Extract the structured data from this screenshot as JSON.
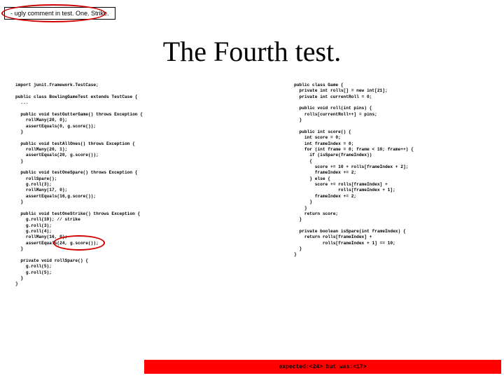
{
  "annotation": "- ugly comment in test. One. Strike.",
  "title": "The Fourth test.",
  "code_left": "import junit.framework.TestCase;\n\npublic class BowlingGameTest extends TestCase {\n  ...\n\n  public void testGutterGame() throws Exception {\n    rollMany(20, 0);\n    assertEquals(0, g.score());\n  }\n\n  public void testAllOnes() throws Exception {\n    rollMany(20, 1);\n    assertEquals(20, g.score());\n  }\n\n  public void testOneSpare() throws Exception {\n    rollSpare();\n    g.roll(3);\n    rollMany(17, 0);\n    assertEquals(16,g.score());\n  }\n\n  public void testOneStrike() throws Exception {\n    g.roll(10); // strike\n    g.roll(3);\n    g.roll(4);\n    rollMany(16, 0);\n    assertEquals(24, g.score());\n  }\n\n  private void rollSpare() {\n    g.roll(5);\n    g.roll(5);\n  }\n}",
  "code_right": "public class Game {\n  private int rolls[] = new int[21];\n  private int currentRoll = 0;\n\n  public void roll(int pins) {\n    rolls[currentRoll++] = pins;\n  }\n\n  public int score() {\n    int score = 0;\n    int frameIndex = 0;\n    for (int frame = 0; frame < 10; frame++) {\n      if (isSpare(frameIndex))\n      {\n        score += 10 + rolls[frameIndex + 2];\n        frameIndex += 2;\n      } else {\n        score += rolls[frameIndex] +\n                 rolls[frameIndex + 1];\n        frameIndex += 2;\n      }\n    }\n    return score;\n  }\n\n  private boolean isSpare(int frameIndex) {\n    return rolls[frameIndex] +\n           rolls[frameIndex + 1] == 10;\n  }\n}",
  "error_text": "expected:<24> but was:<17>"
}
